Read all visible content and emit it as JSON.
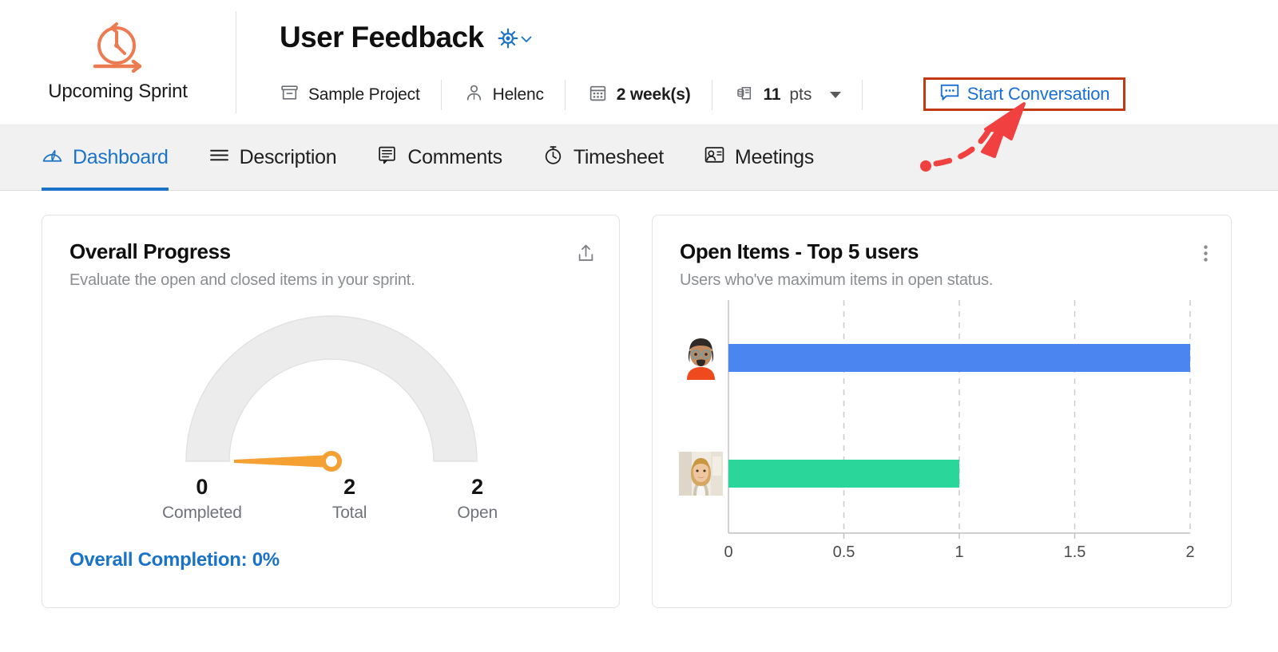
{
  "header": {
    "sprint_label": "Upcoming Sprint",
    "sprint_icon": "sprint-clock-icon",
    "title": "User Feedback",
    "settings_icon": "gear-icon",
    "chevron_icon": "chevron-down-icon",
    "meta": [
      {
        "icon": "project-box-icon",
        "label": "Sample Project"
      },
      {
        "icon": "user-icon",
        "label": "Helenc"
      },
      {
        "icon": "calendar-icon",
        "label": "2 week(s)"
      },
      {
        "icon": "points-icon",
        "label": "11",
        "unit": "pts",
        "has_caret": true
      }
    ],
    "start_conversation": {
      "label": "Start Conversation",
      "icon": "conversation-bubble-icon",
      "highlight_color": "#c03a13",
      "text_color": "#1a6fd4"
    }
  },
  "tabs": [
    {
      "label": "Dashboard",
      "icon": "dashboard-gauge-icon",
      "active": true
    },
    {
      "label": "Description",
      "icon": "hamburger-lines-icon",
      "active": false
    },
    {
      "label": "Comments",
      "icon": "comment-bubble-icon",
      "active": false
    },
    {
      "label": "Timesheet",
      "icon": "stopwatch-icon",
      "active": false
    },
    {
      "label": "Meetings",
      "icon": "meeting-person-icon",
      "active": false
    }
  ],
  "cards": {
    "overall_progress": {
      "title": "Overall Progress",
      "subtitle": "Evaluate the open and closed items in your sprint.",
      "action_icon": "upload-share-icon",
      "completion_text": "Overall Completion: 0%",
      "stats": [
        {
          "value": "0",
          "label": "Completed"
        },
        {
          "value": "2",
          "label": "Total"
        },
        {
          "value": "2",
          "label": "Open"
        }
      ]
    },
    "open_items": {
      "title": "Open Items - Top 5 users",
      "subtitle": "Users who've maximum items in open status.",
      "action_icon": "more-vertical-icon"
    }
  },
  "chart_data": [
    {
      "type": "gauge",
      "title": "Overall Progress",
      "value": 0,
      "min": 0,
      "max": 2,
      "unit": "items",
      "percent": 0,
      "needle_color": "#f5a033",
      "track_color": "#ececec",
      "labels": [
        "Completed",
        "Total",
        "Open"
      ],
      "values": [
        0,
        2,
        2
      ]
    },
    {
      "type": "bar",
      "orientation": "horizontal",
      "title": "Open Items - Top 5 users",
      "subtitle": "Users who've maximum items in open status.",
      "categories": [
        "user-avatar-1",
        "user-avatar-2"
      ],
      "values": [
        2,
        1
      ],
      "colors": [
        "#4b86f0",
        "#2ad69a"
      ],
      "xlabel": "",
      "ylabel": "",
      "xlim": [
        0,
        2
      ],
      "xticks": [
        "0",
        "0.5",
        "1",
        "1.5",
        "2"
      ],
      "grid": true,
      "legend": "none"
    }
  ]
}
